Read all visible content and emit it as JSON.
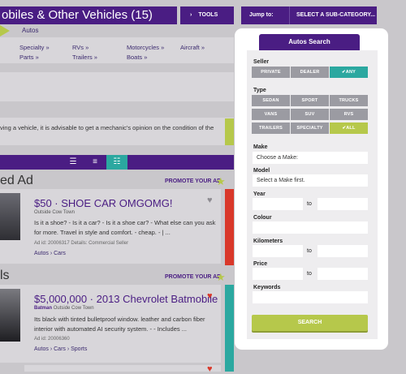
{
  "header": {
    "title": "obiles & Other Vehicles (15)",
    "tools_label": "TOOLS",
    "jump_label": "Jump to:",
    "jump_select": "SELECT A SUB-CATEGORY..."
  },
  "breadcrumb": {
    "current": "Autos"
  },
  "categories": [
    {
      "label": "Specialty »"
    },
    {
      "label": "RVs »"
    },
    {
      "label": "Motorcycles »"
    },
    {
      "label": "Aircraft »"
    },
    {
      "label": "Parts »"
    },
    {
      "label": "Trailers »"
    },
    {
      "label": "Boats »"
    }
  ],
  "notice": {
    "text": "ving a vehicle, it is advisable to get a mechanic's opinion on the condition of the"
  },
  "sections": {
    "featured_title": "ed Ad",
    "promote_label": "PROMOTE YOUR AD",
    "second_title": "ls",
    "promote_label2": "PROMOTE YOUR AD"
  },
  "listings": [
    {
      "title": "$50 · SHOE CAR OMGOMG!",
      "seller": "",
      "location": "Outside Cow Town",
      "desc_line1": "Is it a shoe? - Is it a car? - Is it a shoe car? - What else can you ask",
      "desc_line2": "for more. Travel in style and comfort. - cheap. - | ...",
      "ad_id_label": "Ad id:",
      "ad_id": "20006317",
      "details_label": "Details:",
      "details": "Commercial Seller",
      "cats": "Autos › Cars",
      "heart_color": "#8e8c92"
    },
    {
      "title": "$5,000,000 · 2013 Chevrolet Batmobile",
      "seller": "Batman",
      "location": "Outside Cow Town",
      "desc_line1": "Its black with tinted bulletproof window. leather and carbon fiber",
      "desc_line2": "interior with automated AI security system. - - Includes ...",
      "ad_id_label": "Ad id:",
      "ad_id": "20006360",
      "details_label": "",
      "details": "",
      "cats": "Autos › Cars › Sports",
      "heart_color": "#d9382a"
    }
  ],
  "search": {
    "title": "Autos Search",
    "seller_label": "Seller",
    "seller_options": [
      "PRIVATE",
      "DEALER",
      "✔ANY"
    ],
    "type_label": "Type",
    "type_options": [
      "SEDAN",
      "SPORT",
      "TRUCKS",
      "VANS",
      "SUV",
      "RVS",
      "TRAILERS",
      "SPECIALTY",
      "✔ALL"
    ],
    "make_label": "Make",
    "make_value": "Choose a Make:",
    "model_label": "Model",
    "model_value": "Select a Make first.",
    "year_label": "Year",
    "to_label": "to",
    "colour_label": "Colour",
    "km_label": "Kilometers",
    "price_label": "Price",
    "keywords_label": "Keywords",
    "search_button": "SEARCH"
  },
  "colors": {
    "brand_purple": "#4a1d83",
    "accent_teal": "#2ba8a0",
    "accent_green": "#b6c84b",
    "accent_red": "#d9382a"
  }
}
